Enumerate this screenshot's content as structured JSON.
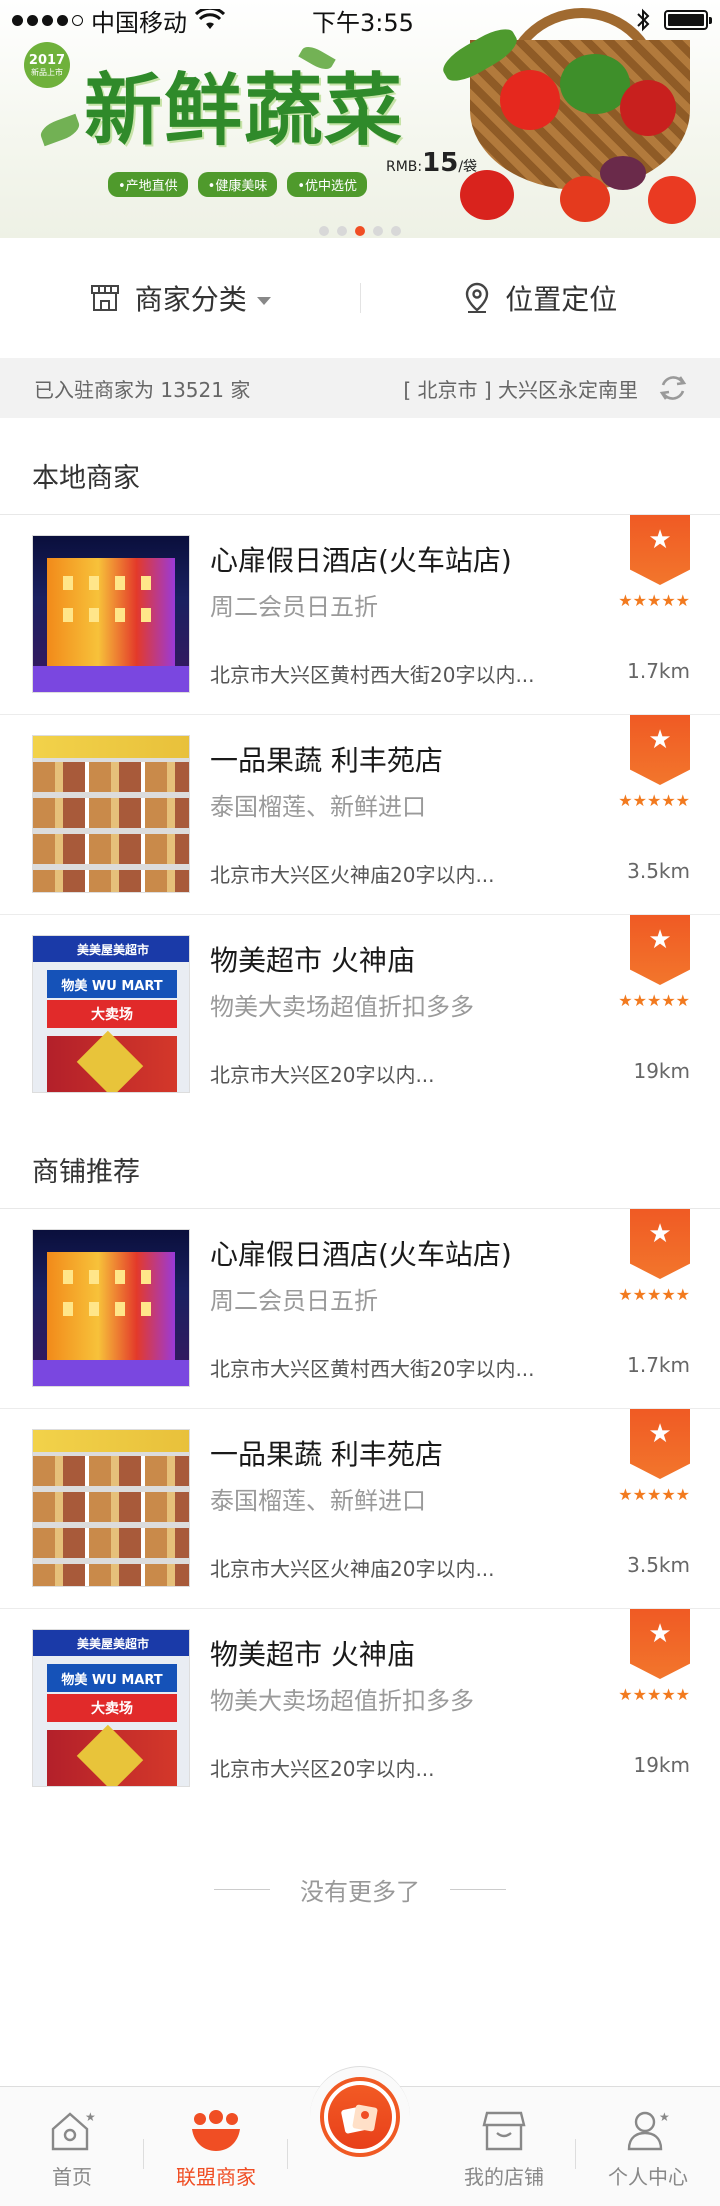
{
  "status_bar": {
    "carrier": "中国移动",
    "time": "下午3:55"
  },
  "banner": {
    "year_badge": "2017",
    "year_badge_sub": "新品上市",
    "title": "新鲜蔬菜",
    "tags": [
      "•产地直供",
      "•健康美味",
      "•优中选优"
    ],
    "price_prefix": "RMB:",
    "price_value": "15",
    "price_unit": "/袋",
    "pager": {
      "count": 5,
      "active_index": 2
    }
  },
  "filters": {
    "category_label": "商家分类",
    "location_label": "位置定位"
  },
  "info": {
    "merchant_count_text": "已入驻商家为 13521 家",
    "location_text": "[ 北京市 ] 大兴区永定南里"
  },
  "sections": {
    "local": {
      "title": "本地商家",
      "items": [
        {
          "name": "心扉假日酒店(火车站店)",
          "promo": "周二会员日五折",
          "address": "北京市大兴区黄村西大街20字以内...",
          "distance": "1.7km",
          "rating": 5
        },
        {
          "name": "一品果蔬 利丰苑店",
          "promo": "泰国榴莲、新鲜进口",
          "address": "北京市大兴区火神庙20字以内...",
          "distance": "3.5km",
          "rating": 5
        },
        {
          "name": "物美超市 火神庙",
          "promo": "物美大卖场超值折扣多多",
          "address": "北京市大兴区20字以内...",
          "distance": "19km",
          "rating": 5
        }
      ]
    },
    "recommended": {
      "title": "商铺推荐",
      "items": [
        {
          "name": "心扉假日酒店(火车站店)",
          "promo": "周二会员日五折",
          "address": "北京市大兴区黄村西大街20字以内...",
          "distance": "1.7km",
          "rating": 5
        },
        {
          "name": "一品果蔬 利丰苑店",
          "promo": "泰国榴莲、新鲜进口",
          "address": "北京市大兴区火神庙20字以内...",
          "distance": "3.5km",
          "rating": 5
        },
        {
          "name": "物美超市 火神庙",
          "promo": "物美大卖场超值折扣多多",
          "address": "北京市大兴区20字以内...",
          "distance": "19km",
          "rating": 5
        }
      ]
    }
  },
  "thumb_text": {
    "mart_top": "美美屋美超市",
    "mart_logo": "物美 WU MART",
    "mart_red": "大卖场"
  },
  "no_more": "没有更多了",
  "tabs": [
    {
      "label": "首页",
      "icon": "home-icon"
    },
    {
      "label": "联盟商家",
      "icon": "alliance-icon",
      "active": true
    },
    {
      "label": "",
      "icon": "red-envelope-icon"
    },
    {
      "label": "我的店铺",
      "icon": "store-icon"
    },
    {
      "label": "个人中心",
      "icon": "profile-icon"
    }
  ],
  "colors": {
    "accent": "#f04e24",
    "star": "#f27a1f",
    "strip_bg": "#f2f2f2"
  }
}
